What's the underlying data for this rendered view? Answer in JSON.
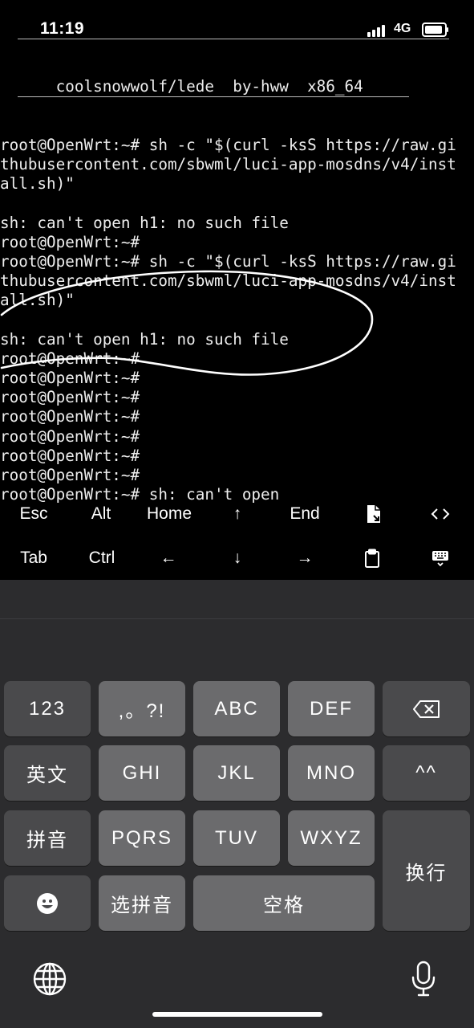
{
  "status": {
    "time": "11:19",
    "network": "4G"
  },
  "terminal": {
    "lines": [
      "",
      "      coolsnowwolf/lede  by-hww  x86_64",
      "",
      "",
      "root@OpenWrt:~# sh -c \"$(curl -ksS https://raw.gi",
      "thubusercontent.com/sbwml/luci-app-mosdns/v4/inst",
      "all.sh)\"",
      "",
      "sh: can't open h1: no such file",
      "root@OpenWrt:~#",
      "root@OpenWrt:~# sh -c \"$(curl -ksS https://raw.gi",
      "thubusercontent.com/sbwml/luci-app-mosdns/v4/inst",
      "all.sh)\"",
      "",
      "sh: can't open h1: no such file",
      "root@OpenWrt:~#",
      "root@OpenWrt:~#",
      "root@OpenWrt:~#",
      "root@OpenWrt:~#",
      "root@OpenWrt:~#",
      "root@OpenWrt:~#",
      "root@OpenWrt:~#",
      "root@OpenWrt:~# sh: can't open"
    ]
  },
  "toolbar": {
    "row1": {
      "esc": "Esc",
      "alt": "Alt",
      "home": "Home",
      "up": "↑",
      "end": "End"
    },
    "row2": {
      "tab": "Tab",
      "ctrl": "Ctrl",
      "left": "←",
      "down": "↓",
      "right": "→"
    }
  },
  "keyboard": {
    "k123": "123",
    "punct": ",。?!",
    "abc": "ABC",
    "def": "DEF",
    "yingwen": "英文",
    "ghi": "GHI",
    "jkl": "JKL",
    "mno": "MNO",
    "kaomoji": "^^",
    "pinyin": "拼音",
    "pqrs": "PQRS",
    "tuv": "TUV",
    "wxyz": "WXYZ",
    "newline": "换行",
    "select_pinyin": "选拼音",
    "space": "空格"
  },
  "colors": {
    "terminal_bg": "#000000",
    "keyboard_bg": "#2c2c2e",
    "key_light": "#6b6b6d",
    "key_dark": "#4a4a4c"
  }
}
